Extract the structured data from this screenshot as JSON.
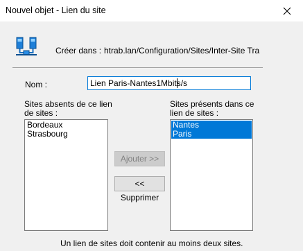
{
  "window": {
    "title": "Nouvel objet - Lien du site",
    "close_icon": "close-icon"
  },
  "header": {
    "icon": "sites-link-icon",
    "create_in_label": "Créer dans :",
    "create_in_path": "htrab.lan/Configuration/Sites/Inter-Site Tra"
  },
  "form": {
    "name_label": "Nom :",
    "name_value": "Lien Paris-Nantes1Mbits/s"
  },
  "absent_sites": {
    "label_line1": "Sites absents de ce lien",
    "label_line2": "de sites :",
    "items": [
      "Bordeaux",
      "Strasbourg"
    ]
  },
  "present_sites": {
    "label_line1": "Sites présents dans ce",
    "label_line2": "lien de sites :",
    "items": [
      "Nantes",
      "Paris"
    ],
    "selected": [
      "Nantes",
      "Paris"
    ]
  },
  "buttons": {
    "add_label": "Ajouter >>",
    "add_enabled": false,
    "remove_label": "<< Supprimer"
  },
  "footer": {
    "hint": "Un lien de sites doit contenir au moins deux sites."
  },
  "colors": {
    "selection": "#0078d7",
    "dialog_bg": "#f0f0f0",
    "focus_border": "#0078d7"
  }
}
